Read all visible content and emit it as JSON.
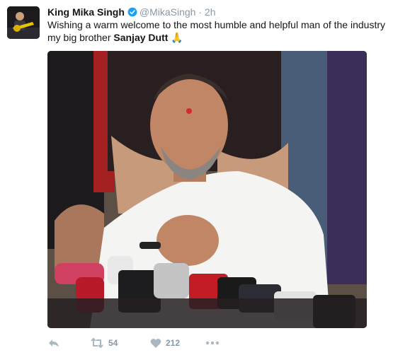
{
  "tweet": {
    "display_name": "King Mika Singh",
    "handle": "@MikaSingh",
    "separator": "·",
    "time": "2h",
    "text_line1": "Wishing a warm welcome to the most humble and helpful man of the industry",
    "text_line2_prefix": "my big brother ",
    "text_bold": "Sanjay Dutt",
    "emoji": "🙏"
  },
  "actions": {
    "reply_icon": "reply-icon",
    "retweet_icon": "retweet-icon",
    "retweet_count": "54",
    "like_icon": "heart-icon",
    "like_count": "212",
    "more_icon": "more-dots-icon"
  },
  "colors": {
    "text": "#14171a",
    "secondary": "#8899a6",
    "verified": "#1da1f2"
  }
}
